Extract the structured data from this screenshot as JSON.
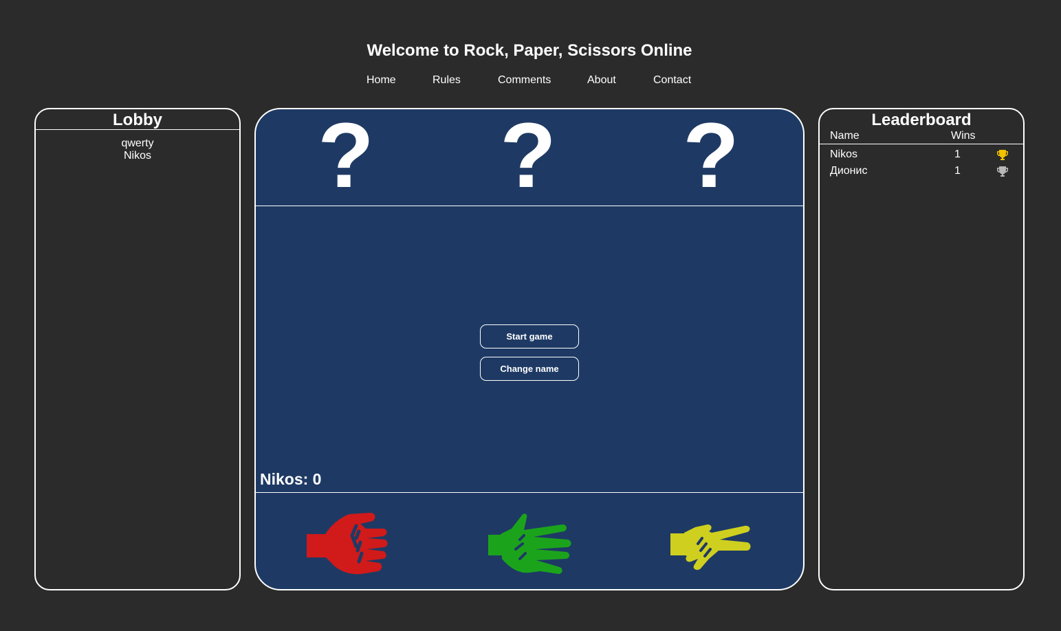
{
  "header": {
    "title": "Welcome to Rock, Paper, Scissors Online",
    "nav": [
      {
        "label": "Home"
      },
      {
        "label": "Rules"
      },
      {
        "label": "Comments"
      },
      {
        "label": "About"
      },
      {
        "label": "Contact"
      }
    ]
  },
  "lobby": {
    "title": "Lobby",
    "players": [
      "qwerty",
      "Nikos"
    ]
  },
  "board": {
    "opponent_slots": [
      "?",
      "?",
      "?"
    ],
    "buttons": {
      "start": "Start game",
      "change_name": "Change name"
    },
    "score": "Nikos: 0",
    "choices": [
      {
        "name": "rock",
        "icon": "fist-icon",
        "color": "#d11a1a"
      },
      {
        "name": "paper",
        "icon": "open-hand-icon",
        "color": "#1ca31c"
      },
      {
        "name": "scissors",
        "icon": "peace-hand-icon",
        "color": "#cfcf1f"
      }
    ]
  },
  "leaderboard": {
    "title": "Leaderboard",
    "columns": {
      "name": "Name",
      "wins": "Wins"
    },
    "rows": [
      {
        "name": "Nikos",
        "wins": "1",
        "trophy": "gold-trophy-icon",
        "trophy_color": "#f2c200"
      },
      {
        "name": "Дионис",
        "wins": "1",
        "trophy": "silver-trophy-icon",
        "trophy_color": "#b8b8b8"
      }
    ]
  },
  "colors": {
    "page_background": "#2b2b2b",
    "board_background": "#1e3a64",
    "border": "#ffffff"
  }
}
